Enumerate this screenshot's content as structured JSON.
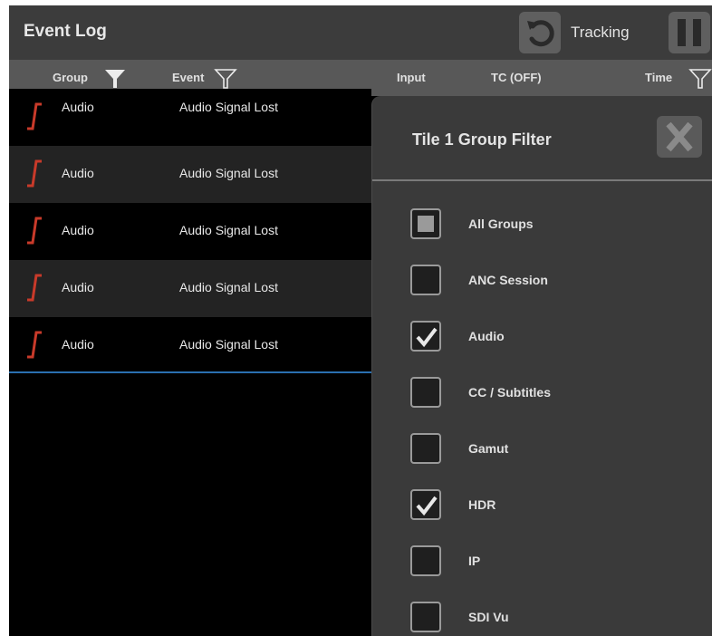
{
  "header": {
    "title": "Event Log",
    "tracking_label": "Tracking"
  },
  "columns": {
    "group": "Group",
    "event": "Event",
    "input": "Input",
    "tc": "TC (OFF)",
    "time": "Time"
  },
  "rows": [
    {
      "group": "Audio",
      "event": "Audio Signal Lost",
      "icon": "signal-edge-icon"
    },
    {
      "group": "Audio",
      "event": "Audio Signal Lost",
      "icon": "signal-edge-icon"
    },
    {
      "group": "Audio",
      "event": "Audio Signal Lost",
      "icon": "signal-edge-icon"
    },
    {
      "group": "Audio",
      "event": "Audio Signal Lost",
      "icon": "signal-edge-icon"
    },
    {
      "group": "Audio",
      "event": "Audio Signal Lost",
      "icon": "signal-edge-icon"
    }
  ],
  "filter_panel": {
    "title": "Tile 1 Group Filter",
    "options": [
      {
        "label": "All Groups",
        "state": "partial"
      },
      {
        "label": "ANC Session",
        "state": "unchecked"
      },
      {
        "label": "Audio",
        "state": "checked"
      },
      {
        "label": "CC / Subtitles",
        "state": "unchecked"
      },
      {
        "label": "Gamut",
        "state": "unchecked"
      },
      {
        "label": "HDR",
        "state": "checked"
      },
      {
        "label": "IP",
        "state": "unchecked"
      },
      {
        "label": "SDI Vu",
        "state": "unchecked"
      }
    ]
  },
  "colors": {
    "signal_icon": "#c83a2a",
    "selection_line": "#2a6fb0",
    "row_dark": "#000000",
    "row_light": "#222222"
  }
}
